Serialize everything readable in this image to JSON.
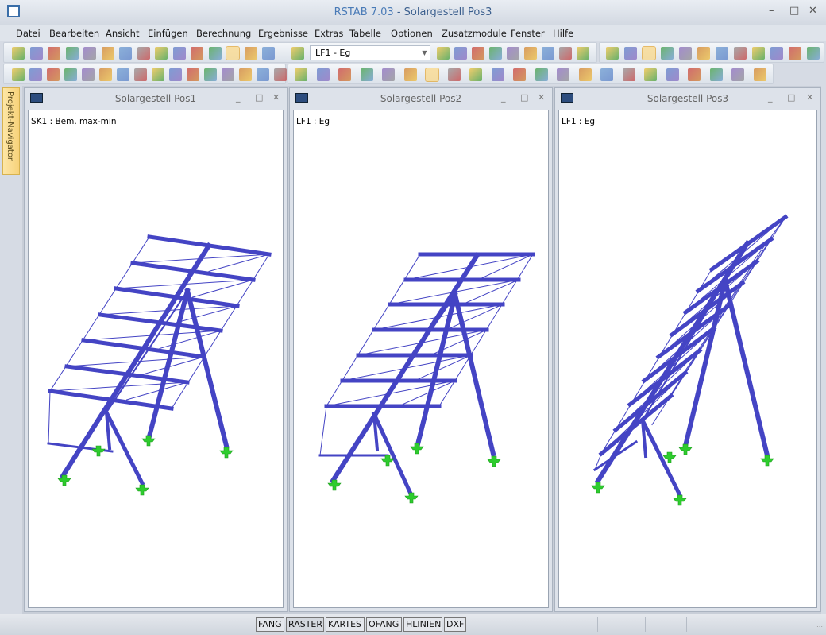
{
  "app": {
    "title_app": "RSTAB 7.03",
    "title_sep": " - ",
    "title_doc": "Solargestell Pos3"
  },
  "menu": [
    "Datei",
    "Bearbeiten",
    "Ansicht",
    "Einfügen",
    "Berechnung",
    "Ergebnisse",
    "Extras",
    "Tabelle",
    "Optionen",
    "Zusatzmodule",
    "Fenster",
    "Hilfe"
  ],
  "toolbar": {
    "loadcase_value": "LF1 - Eg"
  },
  "navigator": {
    "label": "Projekt-Navigator"
  },
  "windows": [
    {
      "title": "Solargestell Pos1",
      "label": "SK1 : Bem. max-min"
    },
    {
      "title": "Solargestell Pos2",
      "label": "LF1 : Eg"
    },
    {
      "title": "Solargestell Pos3",
      "label": "LF1 : Eg"
    }
  ],
  "status": [
    "FANG",
    "RASTER",
    "KARTES",
    "OFANG",
    "HLINIEN",
    "DXF"
  ],
  "status_active": "RASTER",
  "colors": {
    "member": "#4444c4",
    "support": "#2ecc2e",
    "accent": "#4a7bb7"
  },
  "icons_row1": [
    "new-icon",
    "open-icon",
    "archive-icon",
    "copy-icon",
    "save-icon",
    "notes-icon",
    "print-icon",
    "print-preview-icon",
    "undo-icon",
    "redo-icon",
    "edit-icon",
    "select-icon",
    "windows-icon",
    "table-icon",
    "table2-icon",
    "loadcase-icon",
    "prev-icon",
    "next-icon",
    "results-icon",
    "values-icon",
    "view-icon",
    "values2-icon",
    "deform-icon",
    "section-icon",
    "section2-icon",
    "render-icon",
    "grid-icon",
    "view-iso-icon",
    "view-x-icon",
    "view-y-icon",
    "view-3d-icon",
    "link-icon",
    "rotate-icon",
    "mirror-icon",
    "delete-icon",
    "info-icon",
    "settings-icon"
  ],
  "icons_row2": [
    "node-icon",
    "member-icon",
    "set-icon",
    "support-icon",
    "hinge-icon",
    "load-node-icon",
    "load-member-icon",
    "load-set-icon",
    "load-free-icon",
    "dimension-icon",
    "text-icon",
    "clip-icon",
    "filter-icon",
    "zoom-all-icon",
    "zoom-window-icon",
    "zoom-off-icon",
    "view-x-icon",
    "view-y-icon",
    "view-z-icon",
    "view-box-icon",
    "views-icon",
    "wireframe-icon",
    "solid-icon",
    "line-icon",
    "numbering-icon",
    "force-icon",
    "n-icon",
    "vy-icon",
    "vz-icon",
    "mt-icon",
    "my-icon",
    "mz-icon",
    "py-icon",
    "pz-icon",
    "reaction-icon",
    "deflection-icon",
    "panel-icon",
    "report-icon"
  ]
}
